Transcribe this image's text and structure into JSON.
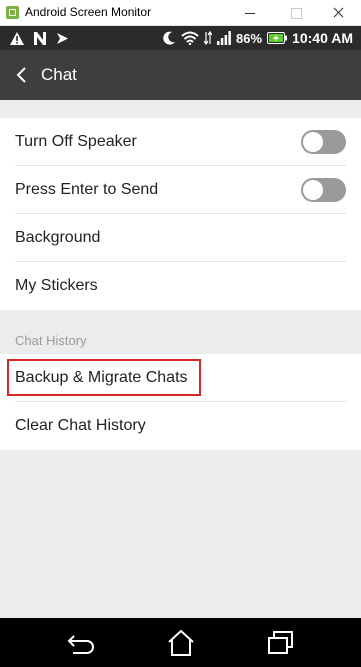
{
  "window": {
    "title": "Android Screen Monitor"
  },
  "status_bar": {
    "battery": "86%",
    "time": "10:40 AM"
  },
  "app_bar": {
    "title": "Chat"
  },
  "settings": {
    "rows": [
      {
        "label": "Turn Off Speaker",
        "toggle": false
      },
      {
        "label": "Press Enter to Send",
        "toggle": false
      },
      {
        "label": "Background"
      },
      {
        "label": "My Stickers"
      }
    ],
    "chat_history": {
      "header": "Chat History",
      "rows": [
        {
          "label": "Backup & Migrate Chats",
          "highlighted": true
        },
        {
          "label": "Clear Chat History"
        }
      ]
    }
  },
  "colors": {
    "highlight": "#d9262b",
    "app_bar": "#3e3e3e",
    "toggle_off": "#9a9a9a"
  },
  "icons": [
    "back-icon",
    "home-icon",
    "recent-apps-icon"
  ]
}
